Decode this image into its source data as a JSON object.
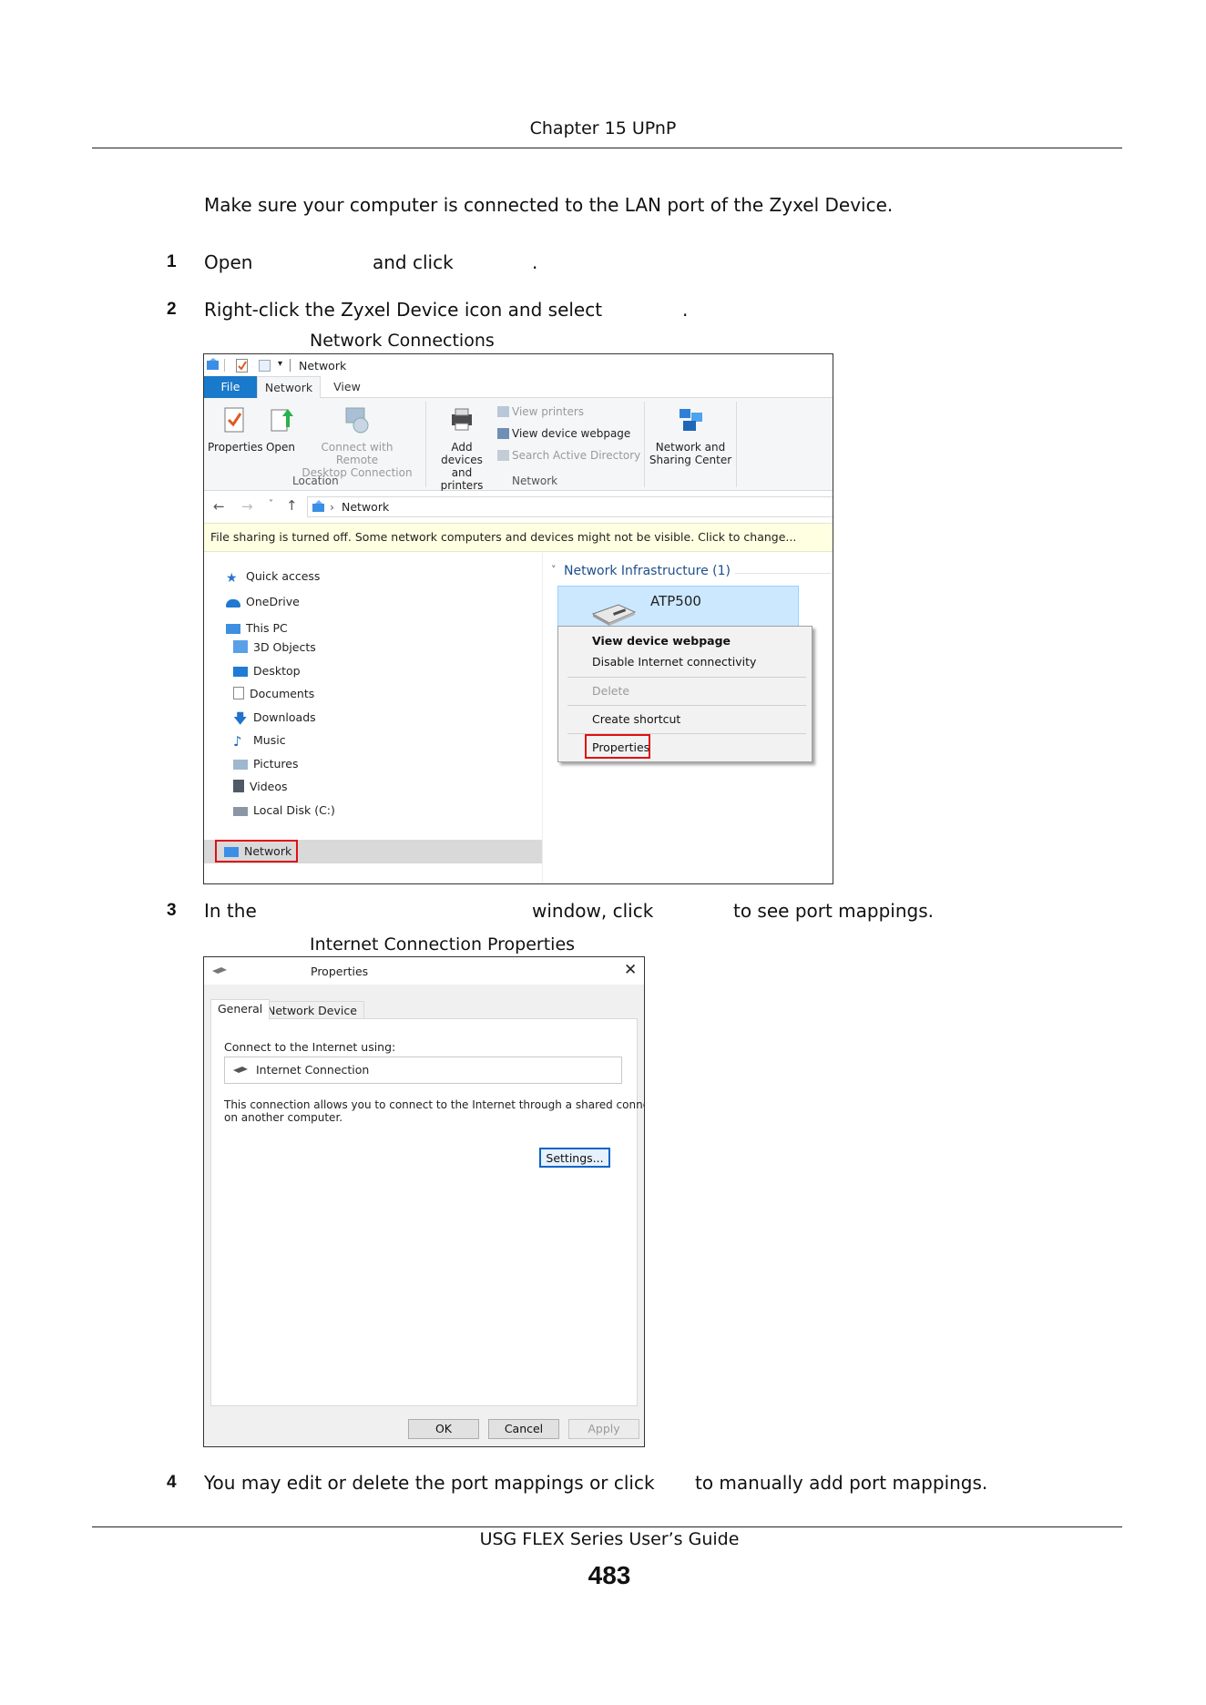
{
  "header": {
    "chapter": "Chapter 15 UPnP"
  },
  "intro": "Make sure your computer is connected to the LAN port of the Zyxel Device.",
  "steps": [
    {
      "number": "1",
      "a": "Open",
      "b": "and click",
      "c": "."
    },
    {
      "number": "2",
      "a": "Right-click the Zyxel Device icon and select",
      "b": "."
    },
    {
      "number": "3",
      "a": "In the",
      "b": "window, click",
      "c": "to see port mappings."
    },
    {
      "number": "4",
      "a": "You may edit or delete the port mappings or click",
      "b": "to manually add port mappings."
    }
  ],
  "figure1": {
    "caption": "Network Connections",
    "qat_title": "Network",
    "tabs": [
      "File",
      "Network",
      "View"
    ],
    "ribbon": {
      "properties": "Properties",
      "open": "Open",
      "connect_remote": [
        "Connect with Remote",
        "Desktop Connection"
      ],
      "location_label": "Location",
      "add_devices": [
        "Add devices",
        "and printers"
      ],
      "view_printers": "View printers",
      "view_device_webpage": "View device webpage",
      "search_ad": "Search Active Directory",
      "network_label": "Network",
      "nsc": [
        "Network and",
        "Sharing Center"
      ]
    },
    "address": "Network",
    "info_bar": "File sharing is turned off. Some network computers and devices might not be visible. Click to change...",
    "nav": [
      "Quick access",
      "OneDrive",
      "This PC",
      "3D Objects",
      "Desktop",
      "Documents",
      "Downloads",
      "Music",
      "Pictures",
      "Videos",
      "Local Disk (C:)",
      "Network"
    ],
    "group": "Network Infrastructure (1)",
    "device": "ATP500",
    "context_menu": [
      "View device webpage",
      "Disable Internet connectivity",
      "Delete",
      "Create shortcut",
      "Properties"
    ],
    "highlight_color": "#e01010"
  },
  "figure2": {
    "caption": "Internet Connection Properties",
    "title": "Properties",
    "tabs": [
      "General",
      "Network Device"
    ],
    "connect_label": "Connect to the Internet using:",
    "connection": "Internet Connection",
    "description": [
      "This connection allows you to connect to the Internet through a shared connection",
      "on another computer."
    ],
    "settings": "Settings...",
    "ok": "OK",
    "cancel": "Cancel",
    "apply": "Apply"
  },
  "footer": {
    "guide": "USG FLEX Series User’s Guide",
    "page": "483"
  }
}
